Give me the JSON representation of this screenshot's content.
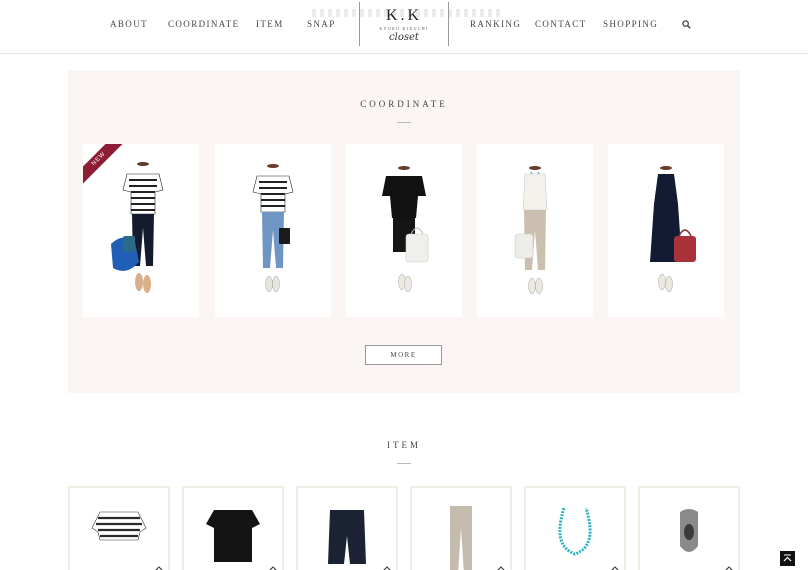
{
  "header": {
    "nav_left": [
      "ABOUT",
      "COORDINATE",
      "ITEM",
      "SNAP"
    ],
    "nav_right": [
      "RANKING",
      "CONTACT",
      "SHOPPING"
    ],
    "logo_main": "K.K",
    "logo_sub": "KYOKO KIKUCHI",
    "logo_script": "closet",
    "search_icon": "search-icon"
  },
  "coordinate": {
    "title": "COORDINATE",
    "new_badge": "NEW",
    "more_label": "MORE",
    "cards": [
      {
        "outfit": "striped tee, navy pants, blue bag"
      },
      {
        "outfit": "striped tee, denim, black clutch"
      },
      {
        "outfit": "black top, black shorts, white bag"
      },
      {
        "outfit": "white tank, linen pants, white bag"
      },
      {
        "outfit": "navy dress, red tote"
      }
    ]
  },
  "item": {
    "title": "ITEM",
    "cards": [
      {
        "item": "striped top"
      },
      {
        "item": "navy tee"
      },
      {
        "item": "navy shorts"
      },
      {
        "item": "linen pants"
      },
      {
        "item": "turquoise necklace"
      },
      {
        "item": "grey socks"
      }
    ]
  },
  "colors": {
    "accent": "#8c1d34",
    "section_bg": "#fbf6f3",
    "item_border": "#f1ece4"
  },
  "icons": [
    "search-icon",
    "hanger-icon",
    "page-top-icon"
  ]
}
